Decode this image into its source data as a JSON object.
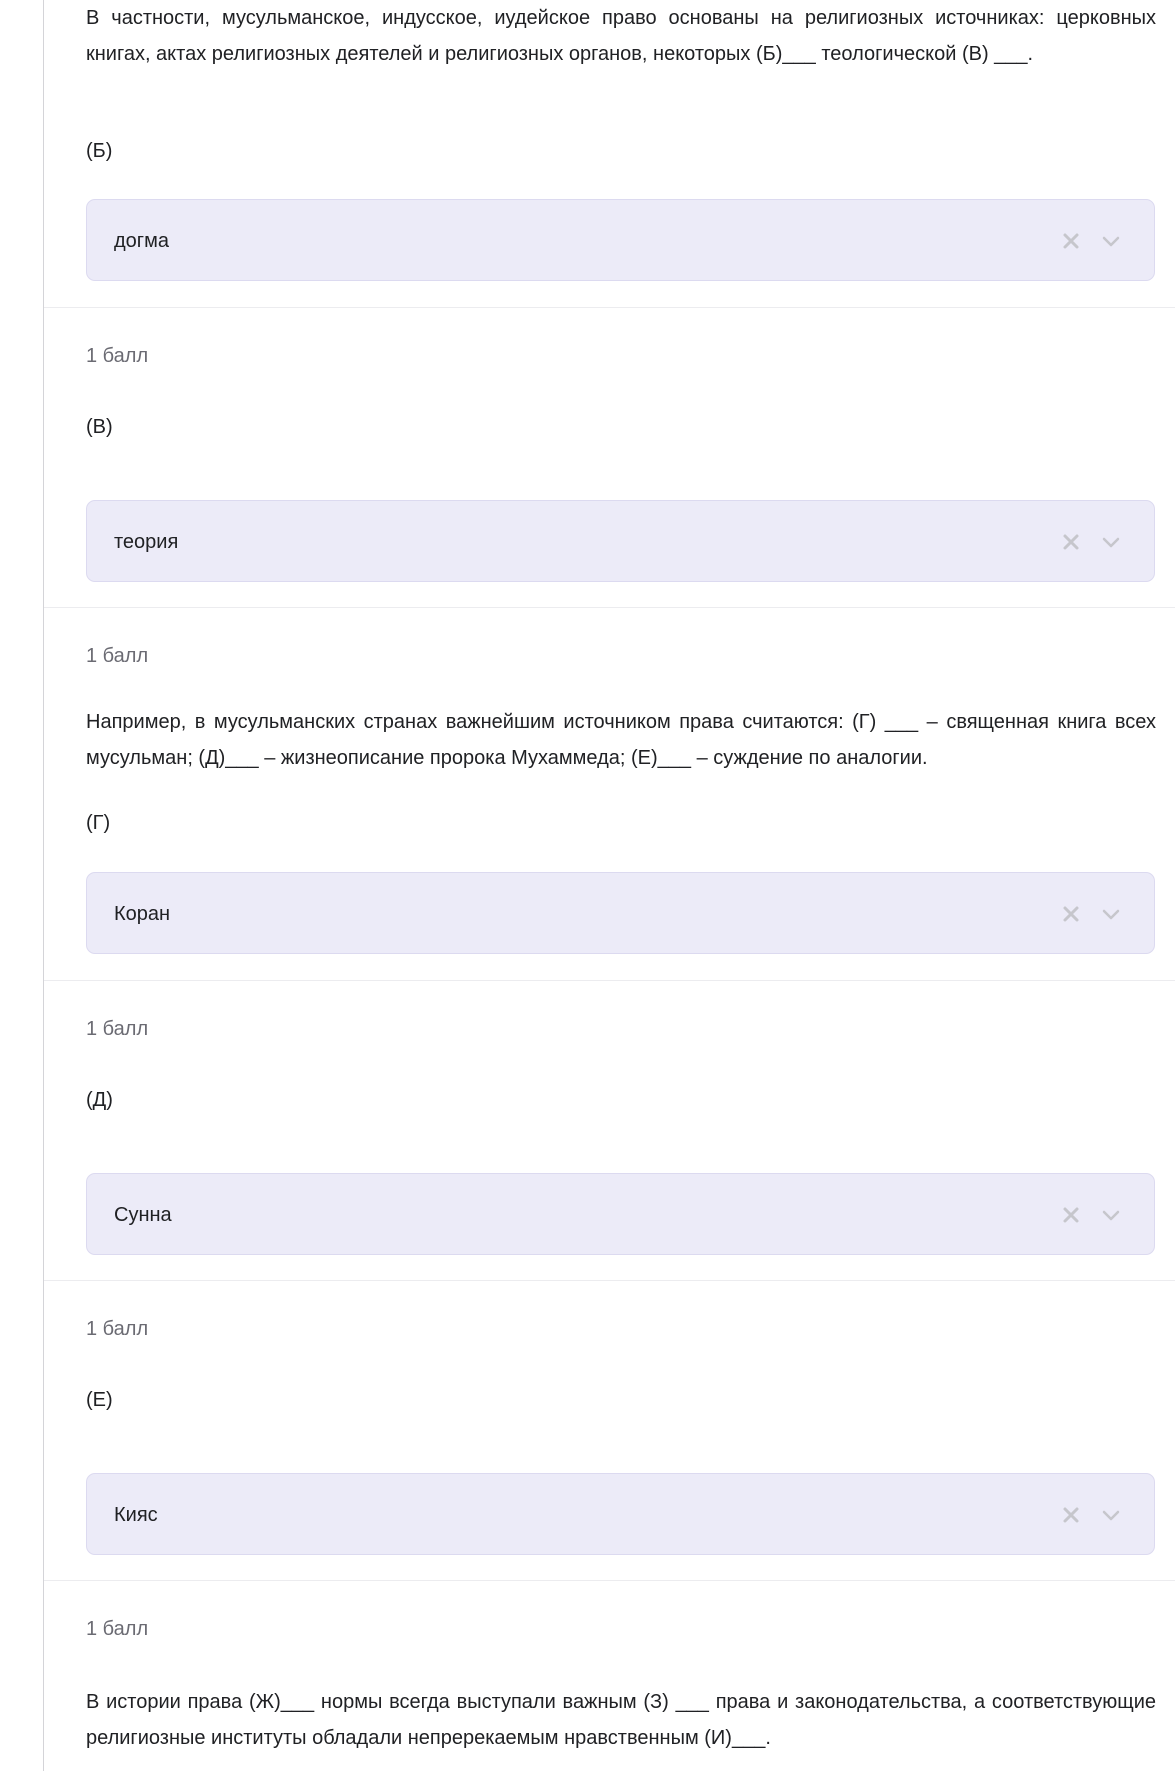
{
  "icons": {
    "clear": "close-icon",
    "expand": "chevron-down-icon",
    "icon_color": "#c6c6cc"
  },
  "colors": {
    "select_background": "#ecebf8",
    "select_border": "#dcdaf0",
    "points_text": "#6b6b73"
  },
  "questions": [
    {
      "paragraph": "В частности, мусульманское, индусское, иудейское право основаны на религиозных источниках: церковных книгах, актах религиозных деятелей и религиозных органов, некоторых (Б)___ теологической (В) ___.",
      "label": "(Б)",
      "selected": "догма"
    },
    {
      "points": "1 балл",
      "label": "(В)",
      "selected": "теория"
    },
    {
      "points": "1 балл",
      "paragraph": "Например, в мусульманских странах важнейшим источником права считаются: (Г) ___ – священная книга всех мусульман; (Д)___ – жизнеописание пророка Мухаммеда; (Е)___ – суждение по аналогии.",
      "label": "(Г)",
      "selected": "Коран"
    },
    {
      "points": "1 балл",
      "label": "(Д)",
      "selected": "Сунна"
    },
    {
      "points": "1 балл",
      "label": "(Е)",
      "selected": "Кияс"
    },
    {
      "points": "1 балл",
      "paragraph": "В истории права (Ж)___ нормы всегда выступали важным (З) ___ права и законодательства, а соответствующие религиозные институты обладали непререкаемым нравственным (И)___."
    }
  ]
}
